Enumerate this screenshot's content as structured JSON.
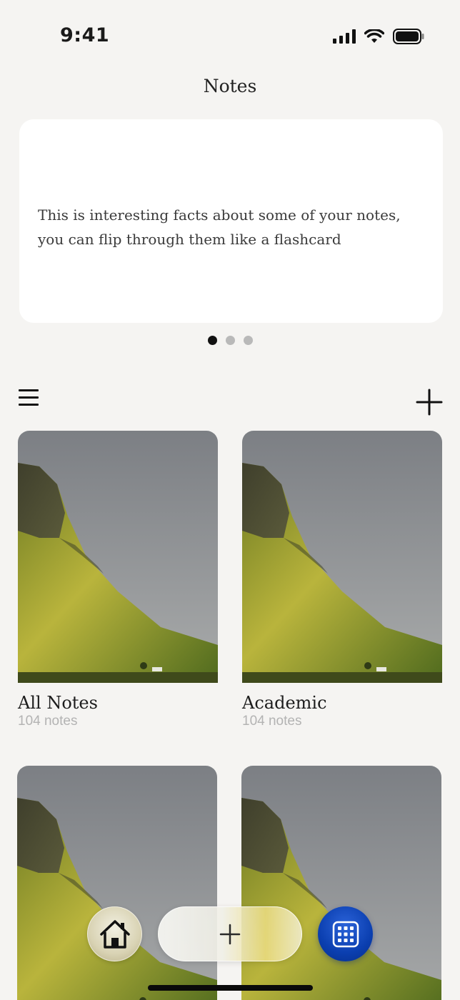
{
  "status_bar": {
    "time": "9:41"
  },
  "header": {
    "title": "Notes"
  },
  "fact_card": {
    "text_line1": "This is interesting facts about some of your notes,",
    "text_line2": "you can flip through them like a flashcard",
    "pages": 3,
    "active_page": 1
  },
  "toolbar": {
    "menu_icon": "hamburger-icon",
    "add_icon": "plus-icon"
  },
  "folders": [
    {
      "name": "All Notes",
      "count": "104 notes"
    },
    {
      "name": "Academic",
      "count": "104 notes"
    },
    {
      "name": "",
      "count": ""
    },
    {
      "name": "",
      "count": ""
    }
  ],
  "bottom_nav": {
    "home_icon": "home-icon",
    "new_icon": "plus-icon",
    "grid_icon": "grid-icon"
  },
  "colors": {
    "background": "#f5f4f2",
    "card": "#ffffff",
    "accent_blue": "#0b3fb0",
    "muted_text": "#b3b3b3"
  }
}
